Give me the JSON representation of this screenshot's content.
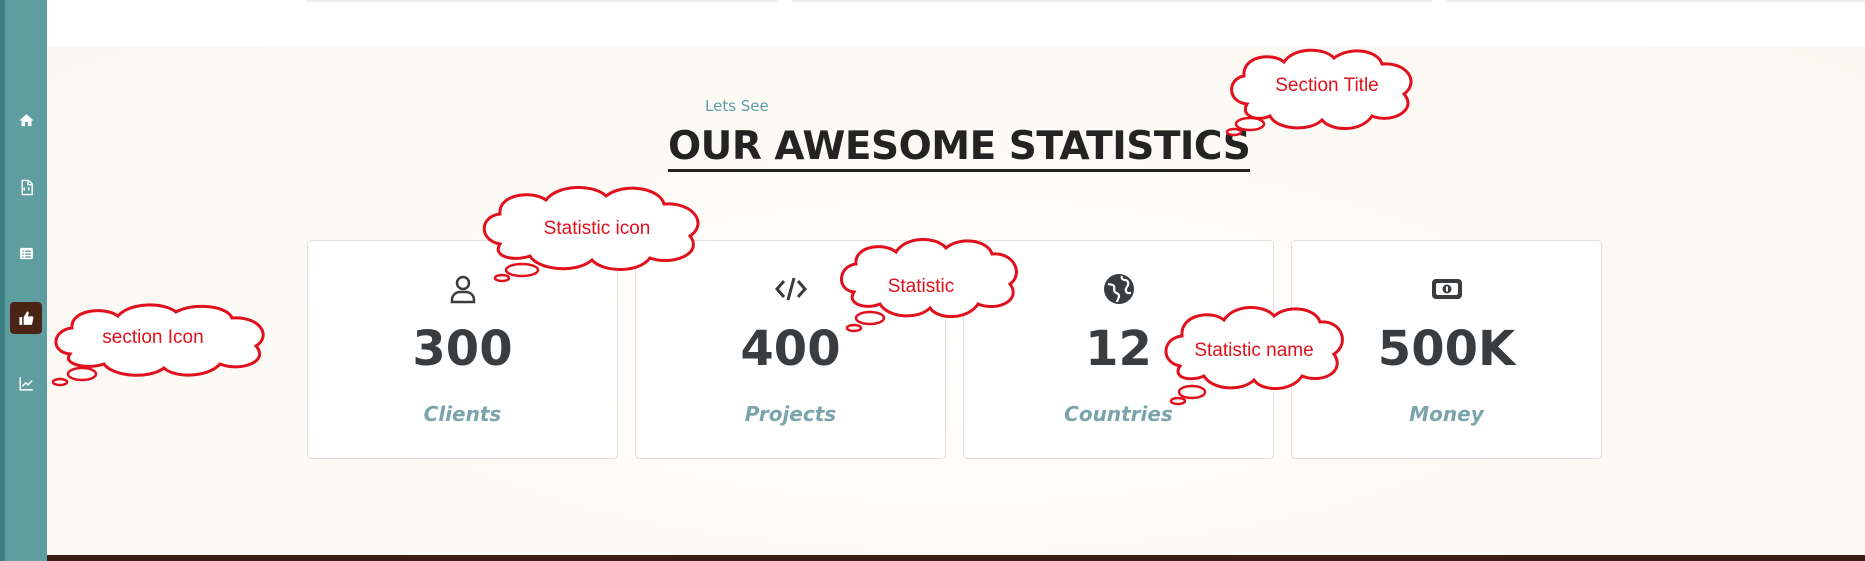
{
  "sidebar": {
    "items": [
      {
        "icon": "home-icon",
        "active": false
      },
      {
        "icon": "file-code-icon",
        "active": false
      },
      {
        "icon": "list-icon",
        "active": false
      },
      {
        "icon": "thumbs-up-icon",
        "active": true
      },
      {
        "icon": "line-chart-icon",
        "active": false
      }
    ]
  },
  "section": {
    "eyebrow": "Lets See",
    "title": "OUR AWESOME STATISTICS"
  },
  "stats": [
    {
      "icon": "user-icon",
      "value": "300",
      "label": "Clients"
    },
    {
      "icon": "code-icon",
      "value": "400",
      "label": "Projects"
    },
    {
      "icon": "globe-icon",
      "value": "12",
      "label": "Countries"
    },
    {
      "icon": "money-bill-icon",
      "value": "500K",
      "label": "Money"
    }
  ],
  "annotations": {
    "section_title": "Section Title",
    "statistic_icon": "Statistic icon",
    "statistic": "Statistic",
    "statistic_name": "Statistic name",
    "section_icon": "section Icon"
  },
  "colors": {
    "sidebar": "#5f9ea0",
    "sidebar_active": "#4a2414",
    "accent": "#5f9ea0",
    "title": "#232323",
    "stat_value": "#3a3d40",
    "stat_label": "#7aa4ab",
    "annotation": "#e0101c"
  }
}
